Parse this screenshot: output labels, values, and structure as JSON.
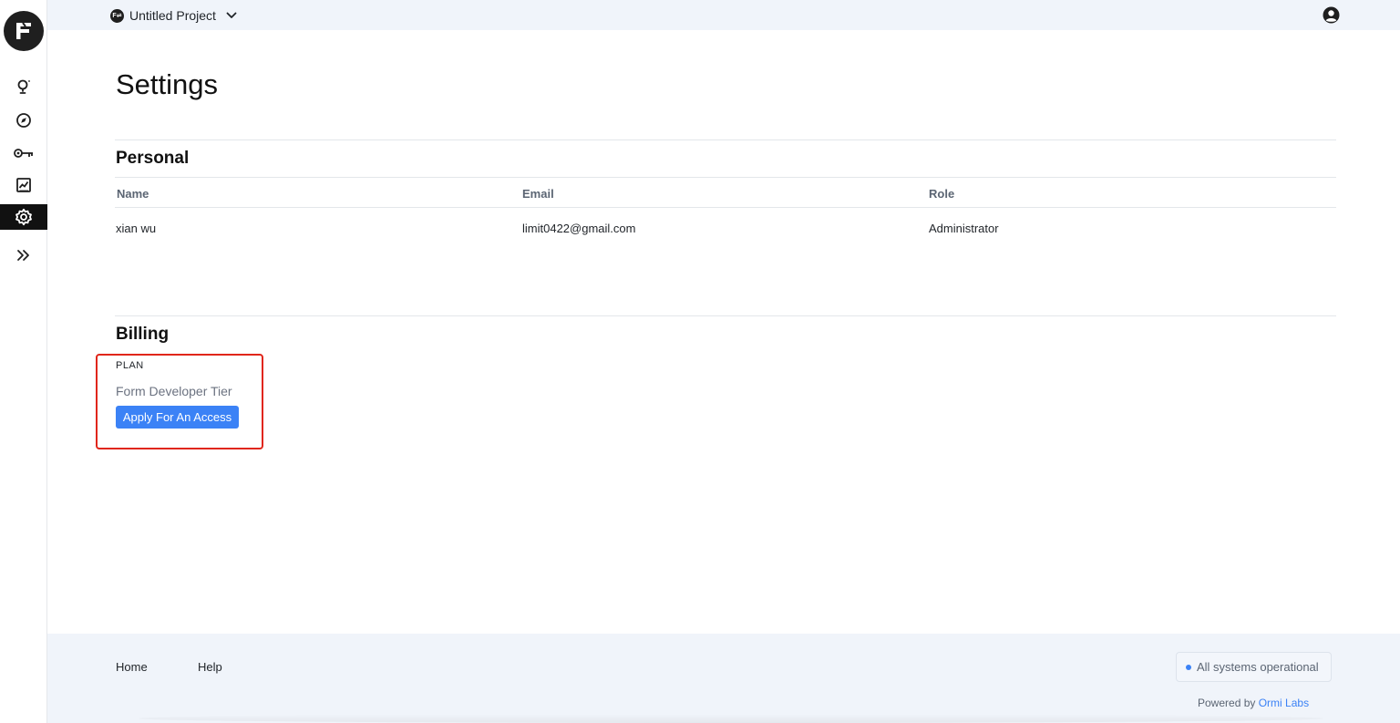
{
  "topbar": {
    "project_icon": "F⇌",
    "project_name": "Untitled Project",
    "dropdown_icon": "chevron-down-icon",
    "user_icon": "user-circle-icon"
  },
  "sidebar": {
    "logo_icon": "f-logo-icon",
    "items": [
      {
        "icon": "ideas-icon",
        "active": false
      },
      {
        "icon": "compass-icon",
        "active": false
      },
      {
        "icon": "key-icon",
        "active": false
      },
      {
        "icon": "chart-icon",
        "active": false
      },
      {
        "icon": "gear-icon",
        "active": true
      },
      {
        "icon": "expand-icon",
        "active": false
      }
    ],
    "active_color": "#111111"
  },
  "main": {
    "title": "Settings",
    "personal": {
      "title": "Personal",
      "columns": [
        "Name",
        "Email",
        "Role"
      ],
      "row": [
        "xian wu",
        "limit0422@gmail.com",
        "Administrator"
      ]
    },
    "billing": {
      "title": "Billing",
      "plan_label": "PLAN",
      "plan_name": "Form Developer Tier",
      "apply_button": "Apply For An Access"
    }
  },
  "footer": {
    "links": [
      "Home",
      "Help"
    ],
    "status": "All systems operational",
    "powered_prefix": "Powered by",
    "powered_link": "Ormi Labs"
  },
  "colors": {
    "accent": "#3b82f6",
    "highlight": "#e0261a",
    "topbar_bg": "#f0f4fa"
  }
}
